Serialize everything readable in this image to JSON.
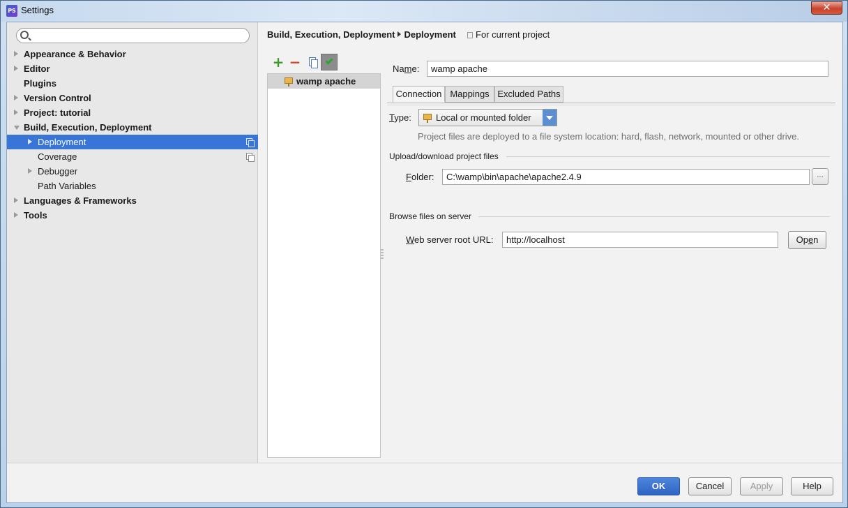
{
  "window": {
    "title": "Settings",
    "app_icon_text": "PS",
    "close_symbol": "✕"
  },
  "sidebar": {
    "search": {
      "value": "",
      "placeholder": ""
    },
    "items": [
      {
        "label": "Appearance & Behavior",
        "bold": true,
        "expander": "collapsed"
      },
      {
        "label": "Editor",
        "bold": true,
        "expander": "collapsed"
      },
      {
        "label": "Plugins",
        "bold": true,
        "expander": "none"
      },
      {
        "label": "Version Control",
        "bold": true,
        "expander": "collapsed"
      },
      {
        "label": "Project: tutorial",
        "bold": true,
        "expander": "collapsed"
      },
      {
        "label": "Build, Execution, Deployment",
        "bold": true,
        "expander": "expanded"
      },
      {
        "label": "Deployment",
        "bold": false,
        "expander": "collapsed",
        "selected": true,
        "project_icon": true
      },
      {
        "label": "Coverage",
        "bold": false,
        "expander": "none",
        "project_icon": true
      },
      {
        "label": "Debugger",
        "bold": false,
        "expander": "collapsed"
      },
      {
        "label": "Path Variables",
        "bold": false,
        "expander": "none"
      },
      {
        "label": "Languages & Frameworks",
        "bold": true,
        "expander": "collapsed"
      },
      {
        "label": "Tools",
        "bold": true,
        "expander": "collapsed"
      }
    ]
  },
  "header": {
    "breadcrumb_parent": "Build, Execution, Deployment",
    "breadcrumb_current": "Deployment",
    "scope": "For current project"
  },
  "toolbar": {
    "add": "+",
    "remove": "−"
  },
  "servers": [
    {
      "name": "wamp apache"
    }
  ],
  "form": {
    "name_label_pre": "Na",
    "name_label_ul": "m",
    "name_label_post": "e:",
    "name_value": "wamp apache",
    "tabs": [
      "Connection",
      "Mappings",
      "Excluded Paths"
    ],
    "type_label_ul": "T",
    "type_label_post": "ype:",
    "type_value": "Local or mounted folder",
    "type_hint": "Project files are deployed to a file system location: hard, flash, network, mounted or other drive.",
    "upload_section": "Upload/download project files",
    "folder_label_ul": "F",
    "folder_label_post": "older:",
    "folder_value": "C:\\wamp\\bin\\apache\\apache2.4.9",
    "browse": "...",
    "browse_section": "Browse files on server",
    "url_label_ul": "W",
    "url_label_post": "eb server root URL:",
    "url_value": "http://localhost",
    "open_pre": "Op",
    "open_ul": "e",
    "open_post": "n"
  },
  "footer": {
    "ok": "OK",
    "cancel": "Cancel",
    "apply": "Apply",
    "help": "Help"
  }
}
